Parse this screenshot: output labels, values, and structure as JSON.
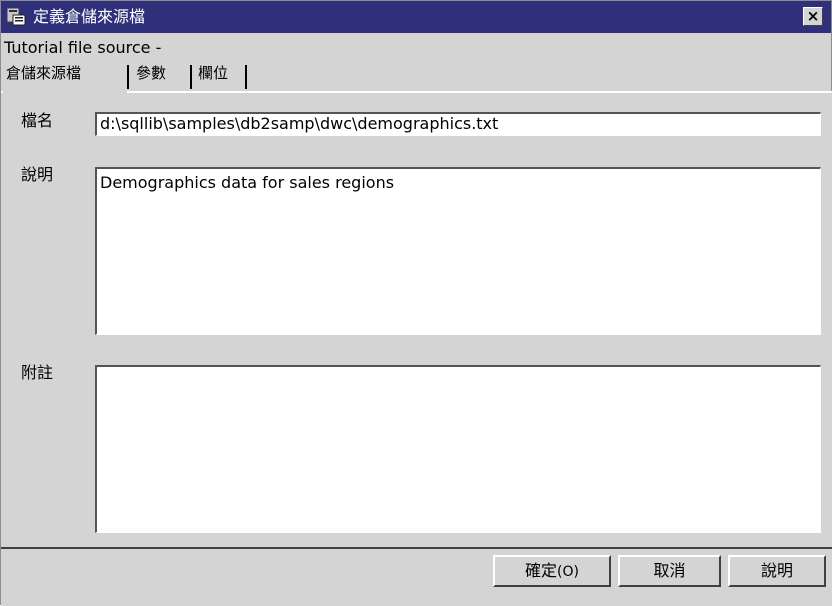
{
  "window": {
    "title": "定義倉儲來源檔",
    "close_label": "×",
    "subtitle": "Tutorial file source -"
  },
  "tabs": [
    {
      "label": "倉儲來源檔",
      "active": true
    },
    {
      "label": "參數",
      "active": false
    },
    {
      "label": "欄位",
      "active": false
    }
  ],
  "form": {
    "file_name_label": "檔名",
    "file_name_value": "d:\\sqllib\\samples\\db2samp\\dwc\\demographics.txt",
    "description_label": "說明",
    "description_value": "Demographics data for sales regions",
    "notes_label": "附註",
    "notes_value": ""
  },
  "buttons": {
    "ok_label": "確定",
    "ok_mnemonic": "(O)",
    "cancel_label": "取消",
    "help_label": "說明"
  },
  "icons": {
    "app": "app-window-icon",
    "close": "close-icon"
  },
  "colors": {
    "titlebar": "#30307a",
    "panel": "#d4d4d4"
  }
}
